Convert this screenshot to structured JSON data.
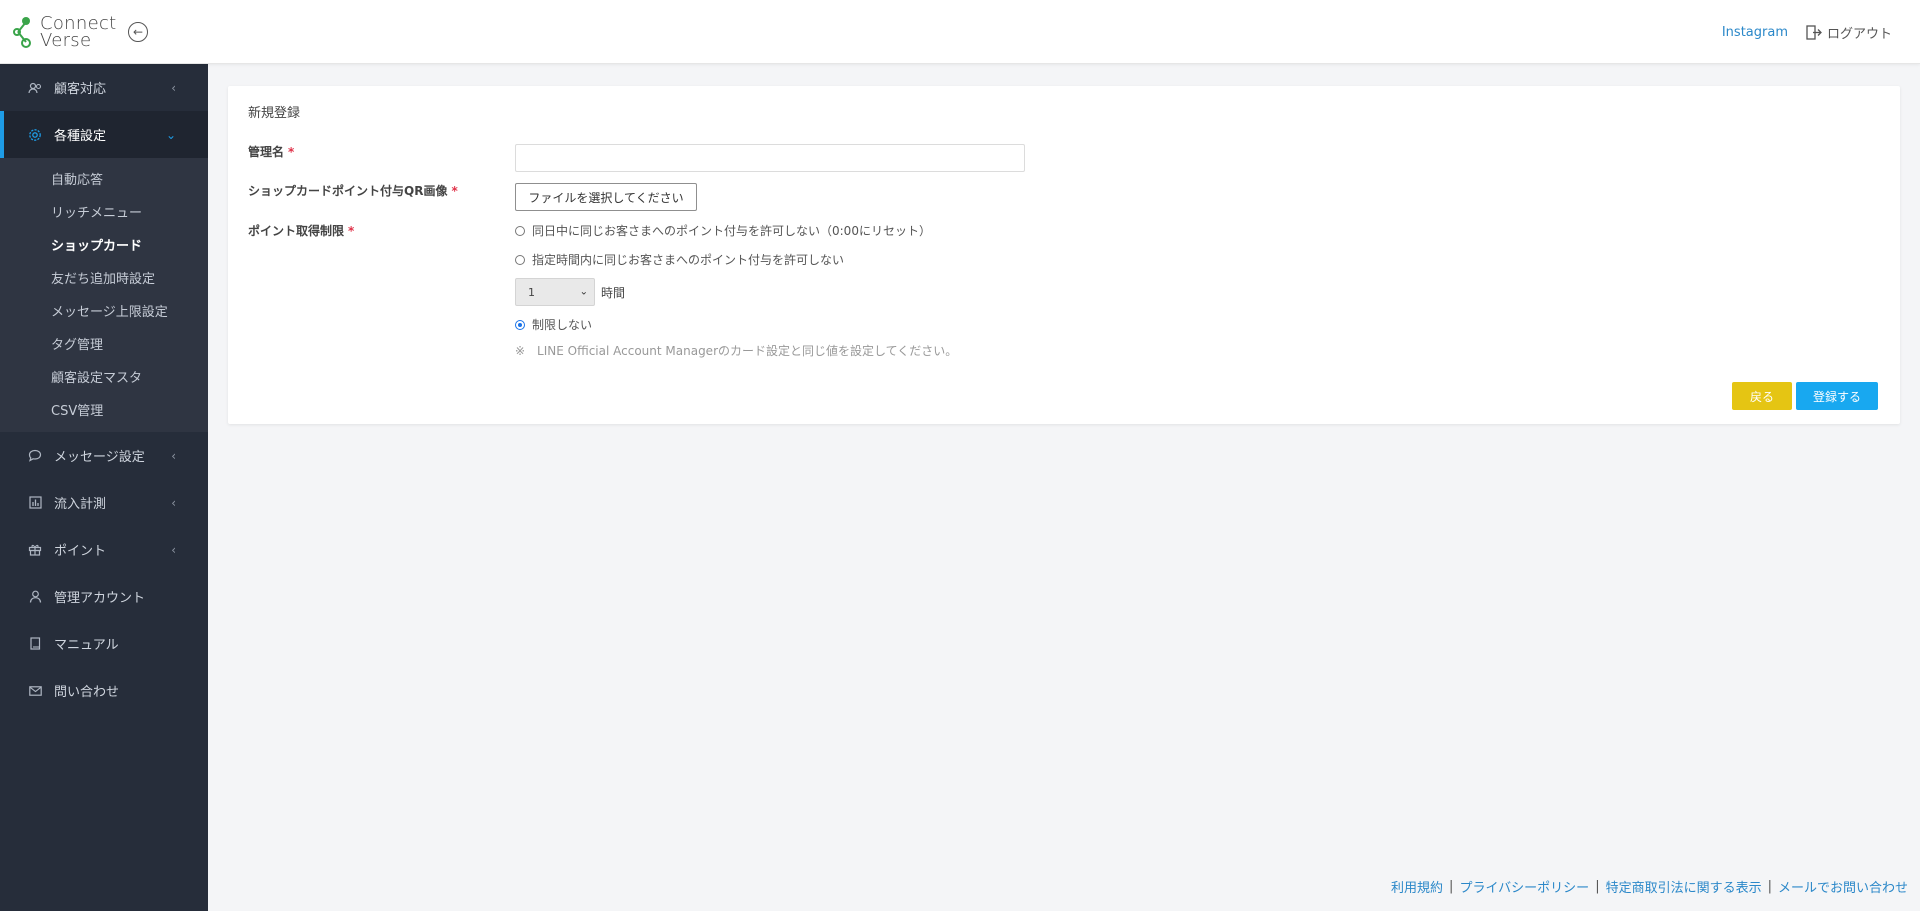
{
  "header": {
    "logo_line1": "Connect",
    "logo_line2": "Verse",
    "instagram_link": "Instagram",
    "logout_label": "ログアウト"
  },
  "sidebar": {
    "items": [
      {
        "label": "顧客対応",
        "icon": "users-icon"
      },
      {
        "label": "各種設定",
        "icon": "gear-icon",
        "active": true
      },
      {
        "label": "メッセージ設定",
        "icon": "chat-icon"
      },
      {
        "label": "流入計測",
        "icon": "bar-chart-icon"
      },
      {
        "label": "ポイント",
        "icon": "gift-icon"
      },
      {
        "label": "管理アカウント",
        "icon": "user-icon"
      },
      {
        "label": "マニュアル",
        "icon": "book-icon"
      },
      {
        "label": "問い合わせ",
        "icon": "mail-icon"
      }
    ],
    "submenu": [
      "自動応答",
      "リッチメニュー",
      "ショップカード",
      "友だち追加時設定",
      "メッセージ上限設定",
      "タグ管理",
      "顧客設定マスタ",
      "CSV管理"
    ],
    "current_submenu": "ショップカード"
  },
  "form": {
    "title": "新規登録",
    "name_label": "管理名",
    "qr_label": "ショップカードポイント付与QR画像",
    "file_button": "ファイルを選択してください",
    "limit_label": "ポイント取得制限",
    "required_mark": "*",
    "options": [
      "同日中に同じお客さまへのポイント付与を許可しない（0:00にリセット）",
      "指定時間内に同じお客さまへのポイント付与を許可しない",
      "制限しない"
    ],
    "selected_option": "制限しない",
    "hour_value": "1",
    "hour_unit": "時間",
    "note": "※　LINE Official Account Managerのカード設定と同じ値を設定してください。",
    "back_button": "戻る",
    "submit_button": "登録する"
  },
  "footer": {
    "links": [
      "利用規約",
      "プライバシーポリシー",
      "特定商取引法に関する表示",
      "メールでお問い合わせ"
    ],
    "separator": "|"
  },
  "colors": {
    "sidebar_bg": "#262d3a",
    "accent": "#1e9ce6",
    "back_button": "#e5c513",
    "submit_button": "#18a8f0"
  }
}
